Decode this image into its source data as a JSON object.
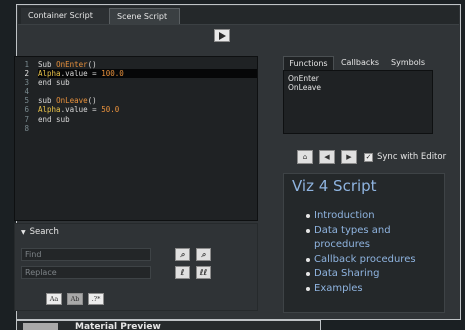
{
  "tabs": [
    {
      "label": "Container Script",
      "active": false
    },
    {
      "label": "Scene Script",
      "active": true
    }
  ],
  "run_button": {
    "icon": "play-icon"
  },
  "editor": {
    "line_numbers": [
      "1",
      "2",
      "3",
      "4",
      "5",
      "6",
      "7",
      "8"
    ],
    "current_line": 2,
    "lines": [
      {
        "kw": "Sub ",
        "fn": "OnEnter",
        "rest": "()"
      },
      {
        "var": "Alpha",
        "rest": ".value = ",
        "num": "100.0"
      },
      {
        "kw": "end sub"
      },
      {},
      {
        "kw": "sub ",
        "fn": "OnLeave",
        "rest": "()"
      },
      {
        "var": "Alpha",
        "rest": ".value = ",
        "num": "50.0"
      },
      {
        "kw": "end sub"
      },
      {}
    ]
  },
  "search": {
    "title": "Search",
    "find_placeholder": "Find",
    "replace_placeholder": "Replace",
    "replace_one_label": "ℓ",
    "replace_all_label": "ℓℓ",
    "match_case_label": "Aa",
    "whole_word_label": "Ab",
    "regex_label": ".?*"
  },
  "side_tabs": [
    {
      "label": "Functions",
      "active": true
    },
    {
      "label": "Callbacks",
      "active": false
    },
    {
      "label": "Symbols",
      "active": false
    }
  ],
  "functions": [
    "OnEnter",
    "OnLeave"
  ],
  "nav": {
    "sync_label": "Sync with Editor",
    "sync_checked": true
  },
  "help": {
    "title": "Viz 4 Script",
    "links": [
      "Introduction",
      "Data types and procedures",
      "Callback procedures",
      "Data Sharing",
      "Examples"
    ]
  },
  "bottom_panel": {
    "title": "Material Preview"
  },
  "colors": {
    "link": "#8fb4e0",
    "keyword_fn": "#e8913c",
    "keyword_var": "#e8c24a"
  }
}
